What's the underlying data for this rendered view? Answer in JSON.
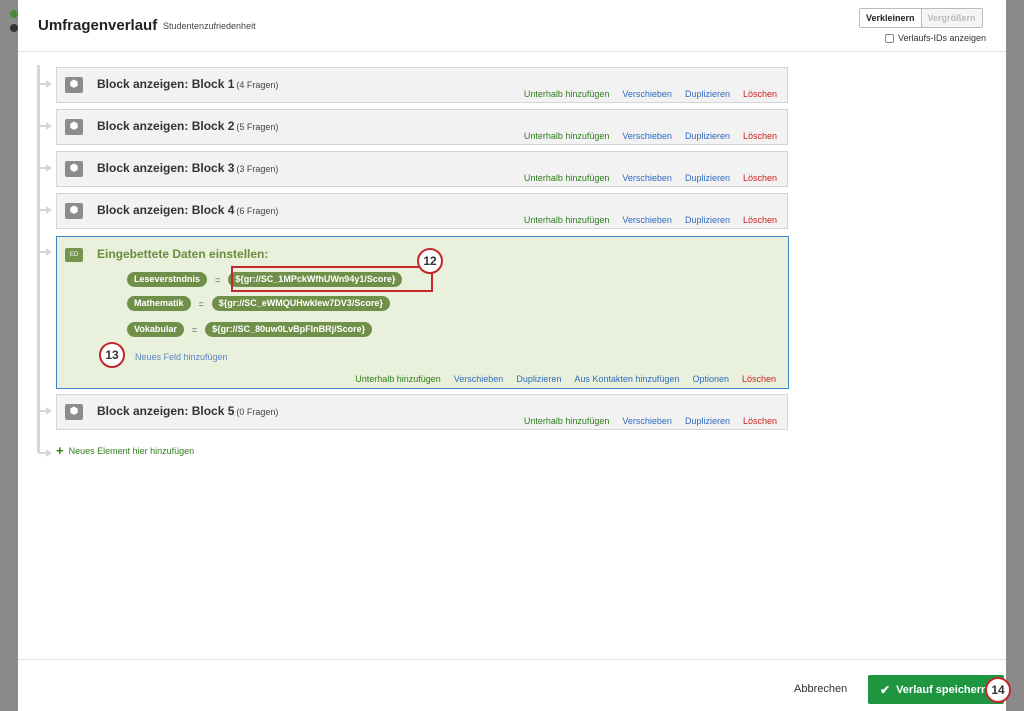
{
  "header": {
    "title": "Umfragenverlauf",
    "subtitle": "Studentenzufriedenheit",
    "zoom_out": "Verkleinern",
    "zoom_in": "Vergrößern",
    "show_ids": "Verlaufs-IDs anzeigen"
  },
  "actions": {
    "add_below": "Unterhalb hinzufügen",
    "move": "Verschieben",
    "duplicate": "Duplizieren",
    "delete": "Löschen",
    "from_contacts": "Aus Kontakten hinzufügen",
    "options": "Optionen"
  },
  "blocks": [
    {
      "label": "Block anzeigen: Block 1",
      "count": "(4 Fragen)"
    },
    {
      "label": "Block anzeigen: Block 2",
      "count": "(5 Fragen)"
    },
    {
      "label": "Block anzeigen: Block 3",
      "count": "(3 Fragen)"
    },
    {
      "label": "Block anzeigen: Block 4",
      "count": "(6 Fragen)"
    },
    {
      "label": "Block anzeigen: Block 5",
      "count": "(0 Fragen)"
    }
  ],
  "embedded": {
    "icon": "ED",
    "title": "Eingebettete Daten einstellen:",
    "fields": [
      {
        "name": "Leseverstndnis",
        "value": "${gr://SC_1MPckWfhUWn94y1/Score}"
      },
      {
        "name": "Mathematik",
        "value": "${gr://SC_eWMQUHwklew7DV3/Score}"
      },
      {
        "name": "Vokabular",
        "value": "${gr://SC_80uw0LvBpFlnBRj/Score}"
      }
    ],
    "eq": "=",
    "add_field": "Neues Feld hinzufügen"
  },
  "add_element": "Neues Element hier hinzufügen",
  "callouts": {
    "c12": "12",
    "c13": "13",
    "c14": "14"
  },
  "footer": {
    "cancel": "Abbrechen",
    "save": "Verlauf speichern"
  },
  "colors": {
    "accent_green": "#1e9640",
    "link_blue": "#2d6bbf",
    "delete_red": "#cc1f1f",
    "callout_red": "#c0282d"
  }
}
